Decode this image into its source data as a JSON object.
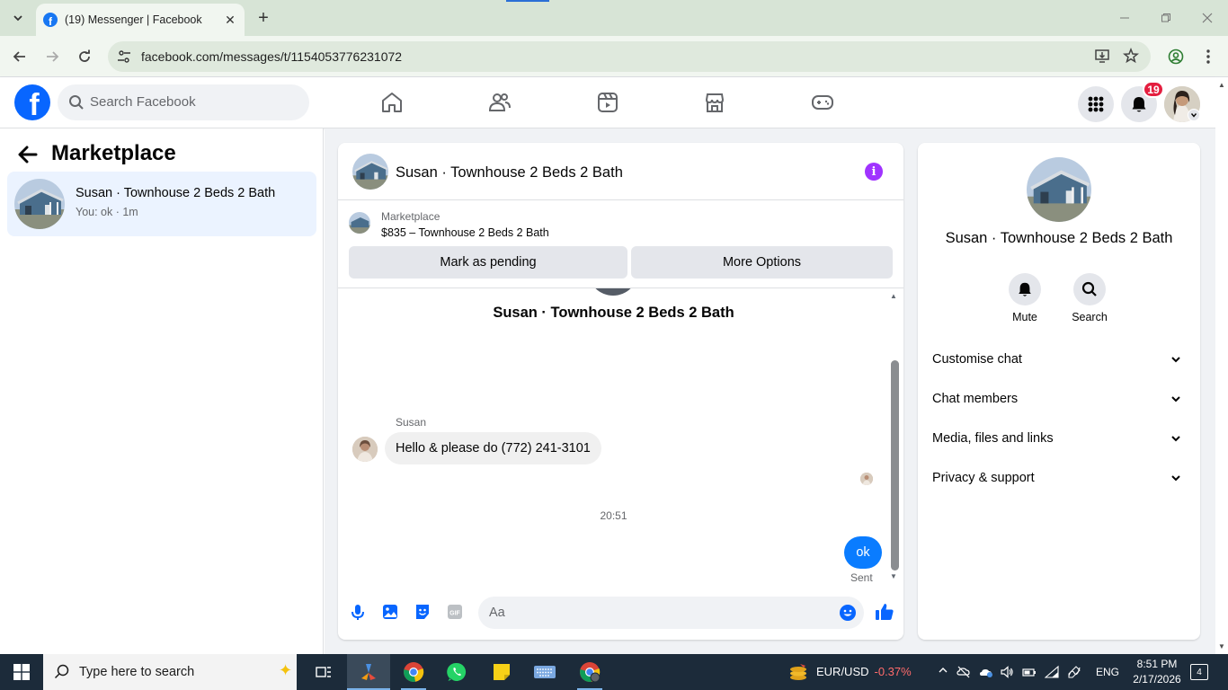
{
  "browser": {
    "tab_title": "(19) Messenger | Facebook",
    "url": "facebook.com/messages/t/1154053776231072",
    "new_tab_symbol": "+",
    "tab_close_symbol": "✕"
  },
  "fb_header": {
    "search_placeholder": "Search Facebook",
    "notification_count": "19",
    "nav_icons": [
      "home-icon",
      "friends-icon",
      "video-icon",
      "marketplace-icon",
      "gaming-icon"
    ]
  },
  "sidebar": {
    "title": "Marketplace",
    "conversation": {
      "name": "Susan · Townhouse 2 Beds 2 Bath",
      "preview": "You: ok · 1m"
    }
  },
  "chat": {
    "header_name": "Susan · Townhouse 2 Beds 2 Bath",
    "marketplace_label": "Marketplace",
    "listing": "$835 – Townhouse 2 Beds 2 Bath",
    "mark_pending_label": "Mark as pending",
    "more_options_label": "More Options",
    "intro_name": "Susan · Townhouse 2 Beds 2 Bath",
    "messages": [
      {
        "sender": "Susan",
        "text": "Hello & please do (772) 241-3101",
        "direction": "incoming"
      },
      {
        "text": "ok",
        "direction": "outgoing",
        "status": "Sent"
      }
    ],
    "time_separator": "20:51",
    "composer_placeholder": "Aa"
  },
  "info_panel": {
    "name": "Susan · Townhouse 2 Beds 2 Bath",
    "actions": [
      {
        "label": "Mute",
        "icon": "bell-icon"
      },
      {
        "label": "Search",
        "icon": "search-icon"
      }
    ],
    "sections": [
      "Customise chat",
      "Chat members",
      "Media, files and links",
      "Privacy & support"
    ]
  },
  "taskbar": {
    "search_placeholder": "Type here to search",
    "ticker_label": "EUR/USD",
    "ticker_change": "-0.37%",
    "language": "ENG",
    "time": "8:51 PM",
    "date": "2/17/2026",
    "notification_count": "4"
  },
  "colors": {
    "fb_blue": "#0866ff",
    "messenger_blue": "#0a7cff",
    "info_purple": "#a033ff",
    "badge_red": "#e41e3f",
    "chrome_green": "#d7e4d6"
  }
}
